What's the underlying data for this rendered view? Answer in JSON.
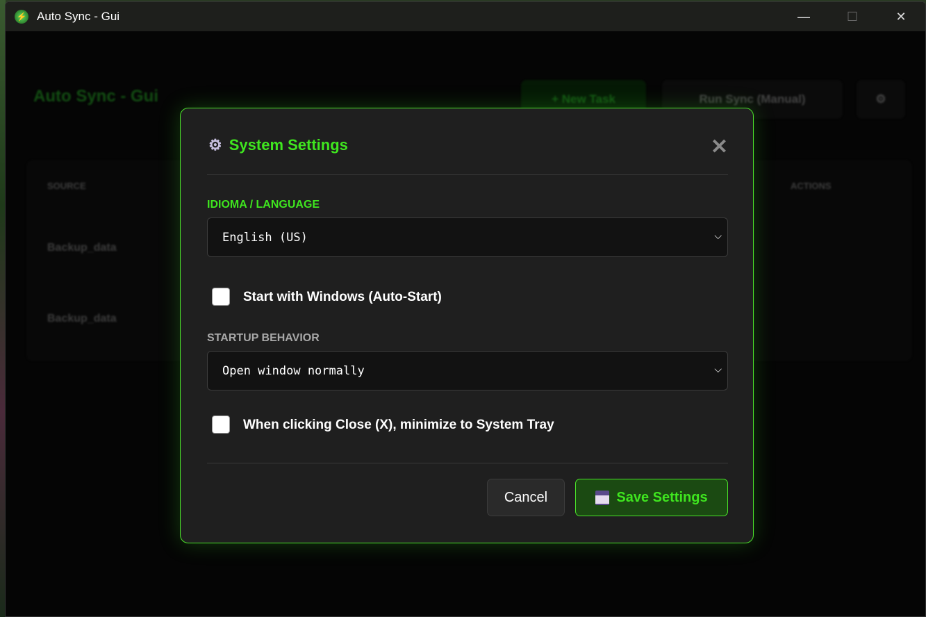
{
  "window": {
    "title": "Auto Sync - Gui",
    "controls": {
      "minimize": "—",
      "maximize": "☐",
      "close": "✕"
    }
  },
  "background": {
    "app_title": "Auto Sync - Gui",
    "new_task_label": "+ New Task",
    "run_sync_label": "Run Sync (Manual)",
    "table_headers": [
      "SOURCE",
      "ACTIONS"
    ],
    "rows": [
      {
        "name": "Backup_data"
      },
      {
        "name": "Backup_data"
      }
    ]
  },
  "dialog": {
    "title": "System Settings",
    "title_icon": "gear-icon",
    "close_label": "✕",
    "language": {
      "label": "IDIOMA / LANGUAGE",
      "value": "English (US)"
    },
    "auto_start": {
      "label": "Start with Windows (Auto-Start)",
      "checked": false
    },
    "startup": {
      "label": "STARTUP BEHAVIOR",
      "value": "Open window normally"
    },
    "tray": {
      "label": "When clicking Close (X), minimize to System Tray",
      "checked": false
    },
    "cancel_label": "Cancel",
    "save_label": "Save Settings",
    "save_icon": "floppy-disk-icon"
  },
  "colors": {
    "accent": "#3fe61f",
    "dialog_bg": "#1f1f1f",
    "save_bg": "#1b4a12"
  }
}
